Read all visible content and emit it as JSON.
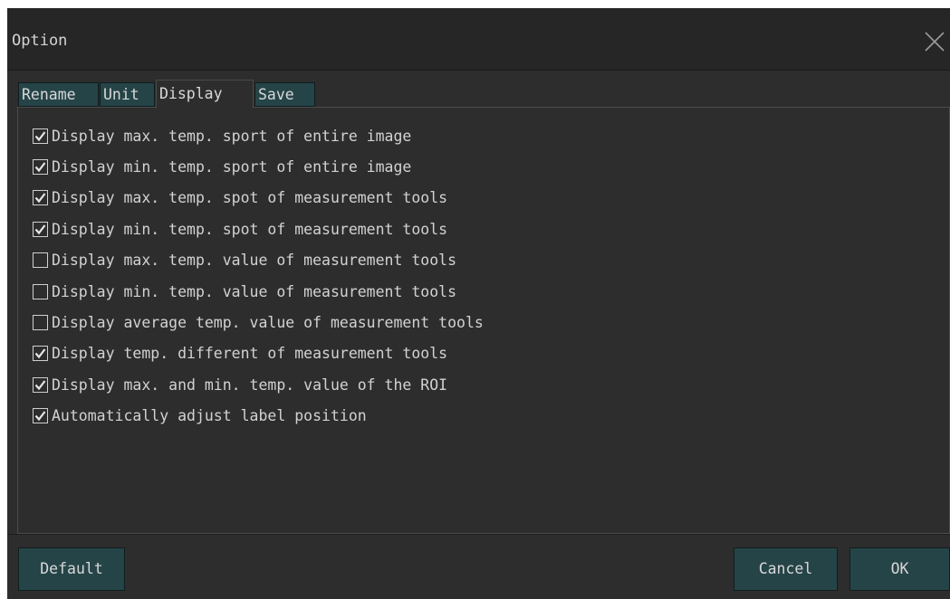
{
  "window": {
    "title": "Option",
    "close_icon": "close-icon"
  },
  "tabs": [
    {
      "label": "Rename",
      "active": false
    },
    {
      "label": "Unit",
      "active": false
    },
    {
      "label": "Display",
      "active": true
    },
    {
      "label": "Save",
      "active": false
    }
  ],
  "options": [
    {
      "label": "Display max. temp. sport of entire image",
      "checked": true
    },
    {
      "label": "Display min. temp. sport of entire image",
      "checked": true
    },
    {
      "label": "Display max. temp. spot of measurement tools",
      "checked": true
    },
    {
      "label": "Display min. temp. spot of measurement tools",
      "checked": true
    },
    {
      "label": "Display max. temp. value of measurement tools",
      "checked": false
    },
    {
      "label": "Display min. temp. value of measurement tools",
      "checked": false
    },
    {
      "label": "Display average temp. value of measurement tools",
      "checked": false
    },
    {
      "label": "Display temp. different of measurement tools",
      "checked": true
    },
    {
      "label": "Display max. and min. temp. value of the ROI",
      "checked": true
    },
    {
      "label": "Automatically adjust label position",
      "checked": true
    }
  ],
  "footer": {
    "default_label": "Default",
    "cancel_label": "Cancel",
    "ok_label": "OK"
  },
  "colors": {
    "dialog_bg": "#2d2d2d",
    "titlebar_bg": "#262626",
    "button_bg": "#254448",
    "text": "#d2d2d2"
  }
}
